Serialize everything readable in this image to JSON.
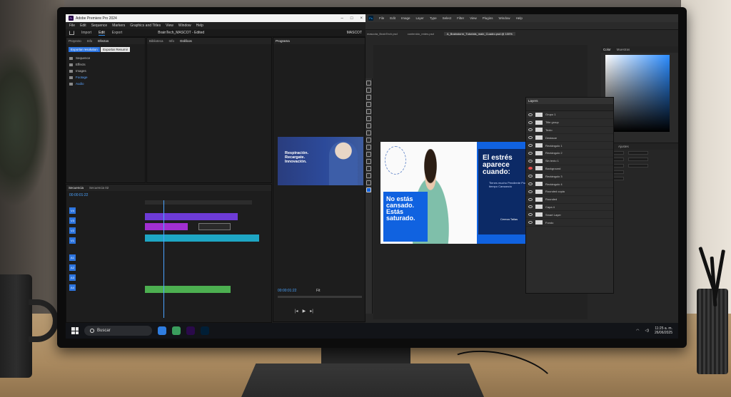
{
  "premiere": {
    "window_title": "Adobe Premiere Pro 2024",
    "logo": "Pr",
    "menu": [
      "File",
      "Edit",
      "Sequence",
      "Markers",
      "Graphics and Titles",
      "View",
      "Window",
      "Help"
    ],
    "workspace_tabs": [
      "Import",
      "Edit",
      "Export"
    ],
    "active_workspace": "Edit",
    "project_title": "BrainTech_MASCOT - Edited",
    "workspace_label": "MASCOT",
    "export_button": "Exportar resolution",
    "export_file_button": "Exportar Resumir",
    "program_ad_text": "Respiración. Recargate. Innovación.",
    "timecode_1": "00:00:01:22",
    "timecode_2": "00:00:01:22",
    "zoom": "Fit"
  },
  "photoshop": {
    "logo": "Ps",
    "menu": [
      "File",
      "Edit",
      "Image",
      "Layer",
      "Type",
      "Select",
      "Filter",
      "View",
      "Plugins",
      "Window",
      "Help"
    ],
    "doc_tab_active": "A_Brainstorm_Tutorials_main_Cuadro.psd @ 100%",
    "layers_panel_title": "Layers",
    "layers": [
      {
        "name": "Grupo 1",
        "visible": true
      },
      {
        "name": "Title group",
        "visible": true
      },
      {
        "name": "Texto",
        "visible": true
      },
      {
        "name": "Destacar",
        "visible": true
      },
      {
        "name": "Rectángulo 1",
        "visible": true
      },
      {
        "name": "Rectángulo 2",
        "visible": true
      },
      {
        "name": "Sin texto 1",
        "visible": true
      },
      {
        "name": "Background",
        "visible": false
      },
      {
        "name": "Rectángulo 3",
        "visible": true
      },
      {
        "name": "Rectángulo 4",
        "visible": true
      },
      {
        "name": "Rounded copia",
        "visible": true
      },
      {
        "name": "Rounded",
        "visible": true
      },
      {
        "name": "Capa 4",
        "visible": true
      },
      {
        "name": "Smart Layer",
        "visible": true
      },
      {
        "name": "Fondo",
        "visible": true
      }
    ]
  },
  "poster": {
    "headline": "El estrés aparece cuando:",
    "badge_text": "No estás cansado. Estás saturado.",
    "list_text": "Tienes mucho Pendiente Poco tiempo Cansancio",
    "logo_text": "Cereza Tallas",
    "colors": {
      "blue": "#1062e0",
      "navy": "#0c2a66"
    }
  },
  "taskbar": {
    "search_placeholder": "Buscar",
    "time": "11:25 a. m.",
    "date": "26/06/2025"
  }
}
